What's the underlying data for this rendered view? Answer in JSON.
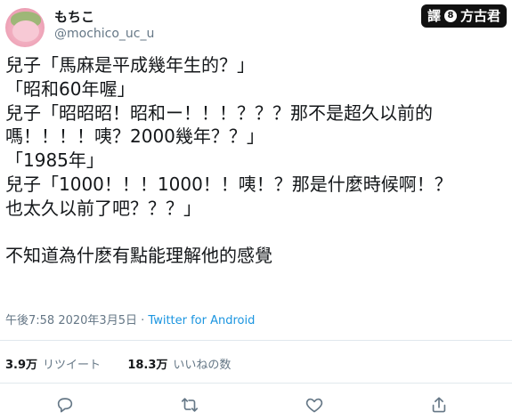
{
  "user": {
    "display_name": "もちこ",
    "handle": "@mochico_uc_u"
  },
  "watermark": {
    "prefix": "譯",
    "badge": "8",
    "name": "方古君"
  },
  "tweet": {
    "lines": [
      "兒子「馬麻是平成幾年生的？」",
      "「昭和60年喔」",
      "兒子「昭昭昭！昭和ー！！！？？？那不是超久以前的",
      "嗎！！！！咦？2000幾年？？」",
      "「1985年」",
      "兒子「1000！！！1000！！咦！？那是什麼時候啊！？",
      "也太久以前了吧？？？」",
      "",
      "不知道為什麽有點能理解他的感覺"
    ]
  },
  "meta": {
    "time": "午後7:58",
    "sep": "·",
    "date": "2020年3月5日",
    "client": "Twitter for Android"
  },
  "stats": {
    "retweets_count": "3.9万",
    "retweets_label": "リツイート",
    "likes_count": "18.3万",
    "likes_label": "いいねの数"
  },
  "actions": [
    "reply-icon",
    "retweet-icon",
    "like-icon",
    "share-icon"
  ],
  "colors": {
    "text": "#14171a",
    "muted": "#657786",
    "link": "#1b95e0",
    "divider": "#e1e8ed"
  }
}
